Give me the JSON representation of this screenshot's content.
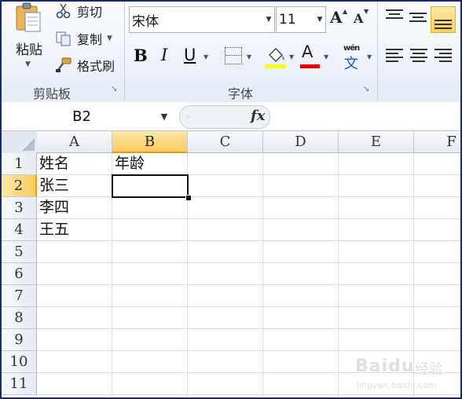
{
  "ribbon": {
    "clipboard": {
      "group_label": "剪贴板",
      "paste_label": "粘贴",
      "cut_label": "剪切",
      "copy_label": "复制",
      "format_painter_label": "格式刷",
      "icons": [
        "paste-icon",
        "scissors-icon",
        "copy-icon",
        "format-painter-icon"
      ]
    },
    "font": {
      "group_label": "字体",
      "font_name": "宋体",
      "font_size": "11",
      "grow_label": "A",
      "shrink_label": "A",
      "bold_label": "B",
      "italic_label": "I",
      "underline_label": "U",
      "font_color_label": "A",
      "phonetic_top": "wén",
      "phonetic_bottom": "文",
      "fill_color": "#ffff00",
      "font_color": "#e00000"
    },
    "launcher_glyph": "↘"
  },
  "formula_bar": {
    "name_box": "B2",
    "fx_label": "fx",
    "formula_value": ""
  },
  "sheet": {
    "columns": [
      "A",
      "B",
      "C",
      "D",
      "E",
      "F"
    ],
    "rows": [
      "1",
      "2",
      "3",
      "4",
      "5",
      "6",
      "7",
      "8",
      "9",
      "10",
      "11"
    ],
    "selected_column": "B",
    "selected_row": "2",
    "cells": {
      "A1": "姓名",
      "B1": "年龄",
      "A2": "张三",
      "A3": "李四",
      "A4": "王五"
    }
  },
  "watermark": {
    "brand": "Baidu",
    "cn": "经验",
    "url": "jingyan.baidu.com"
  },
  "colors": {
    "accent_selection": "#f9cb5e",
    "frame": "#1a2a6c"
  }
}
